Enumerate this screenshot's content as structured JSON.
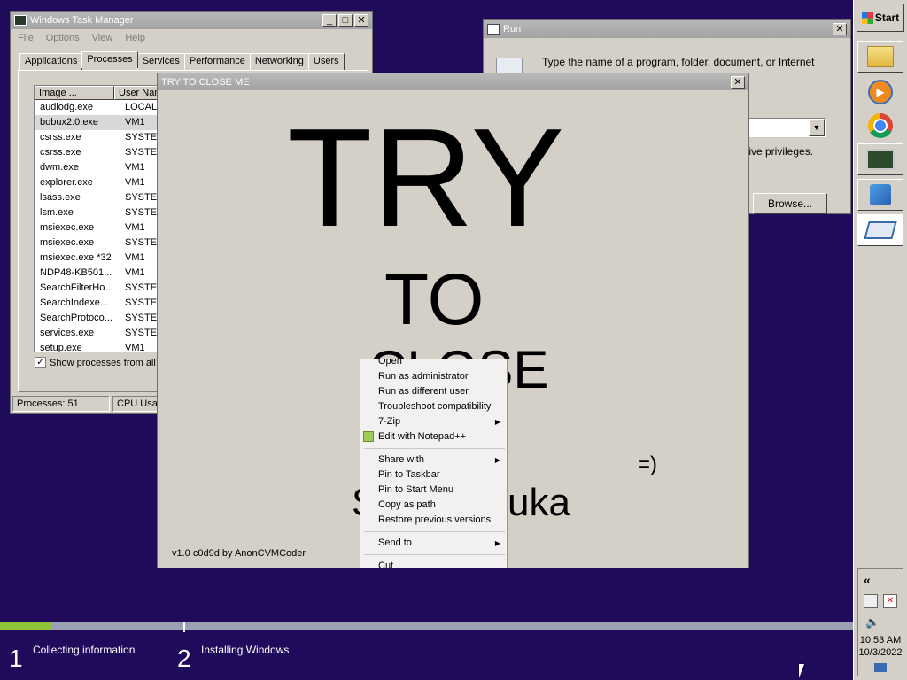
{
  "task_manager": {
    "title": "Windows Task Manager",
    "menu": [
      "File",
      "Options",
      "View",
      "Help"
    ],
    "tabs": [
      "Applications",
      "Processes",
      "Services",
      "Performance",
      "Networking",
      "Users"
    ],
    "active_tab": "Processes",
    "columns": [
      "Image ...",
      "User Nam"
    ],
    "processes": [
      {
        "image": "audiodg.exe",
        "user": "LOCAL ..."
      },
      {
        "image": "bobux2.0.exe",
        "user": "VM1"
      },
      {
        "image": "csrss.exe",
        "user": "SYSTEM"
      },
      {
        "image": "csrss.exe",
        "user": "SYSTEM"
      },
      {
        "image": "dwm.exe",
        "user": "VM1"
      },
      {
        "image": "explorer.exe",
        "user": "VM1"
      },
      {
        "image": "lsass.exe",
        "user": "SYSTEM"
      },
      {
        "image": "lsm.exe",
        "user": "SYSTEM"
      },
      {
        "image": "msiexec.exe",
        "user": "VM1"
      },
      {
        "image": "msiexec.exe",
        "user": "SYSTEM"
      },
      {
        "image": "msiexec.exe *32",
        "user": "VM1"
      },
      {
        "image": "NDP48-KB501...",
        "user": "VM1"
      },
      {
        "image": "SearchFilterHo...",
        "user": "SYSTEM"
      },
      {
        "image": "SearchIndexe...",
        "user": "SYSTEM"
      },
      {
        "image": "SearchProtoco...",
        "user": "SYSTEM"
      },
      {
        "image": "services.exe",
        "user": "SYSTEM"
      },
      {
        "image": "setup.exe",
        "user": "VM1"
      }
    ],
    "show_all_label": "Show processes from all u",
    "status_processes": "Processes: 51",
    "status_cpu": "CPU Usage"
  },
  "run_dialog": {
    "title": "Run",
    "description": "Type the name of a program, folder, document, or Internet",
    "privileges_text": "tive privileges.",
    "browse_label": "Browse..."
  },
  "try_window": {
    "title": "TRY TO CLOSE ME",
    "big_try": "TRY",
    "big_to": "TO",
    "big_close": "CLOSE",
    "smiley": "=)",
    "s_letter": "S",
    "uka": "uka",
    "footer": "v1.0 c0d9d by AnonCVMCoder"
  },
  "context_menu": {
    "items_a": [
      "Open",
      "Run as administrator",
      "Run as different user",
      "Troubleshoot compatibility",
      "7-Zip",
      "Edit with Notepad++"
    ],
    "items_b": [
      "Share with",
      "Pin to Taskbar",
      "Pin to Start Menu",
      "Copy as path",
      "Restore previous versions"
    ],
    "items_c": [
      "Send to"
    ],
    "items_d": [
      "Cut"
    ]
  },
  "taskbar": {
    "start_label": "Start",
    "apps": [
      "folder-icon",
      "media-player-icon",
      "chrome-icon",
      "task-manager-icon",
      "installer-icon",
      "run-window-icon"
    ],
    "tray_chevron": "«",
    "time": "10:53 AM",
    "date": "10/3/2022"
  },
  "setup": {
    "progress": 0.06,
    "step1_num": "1",
    "step1_label": "Collecting information",
    "step2_num": "2",
    "step2_label": "Installing Windows"
  }
}
